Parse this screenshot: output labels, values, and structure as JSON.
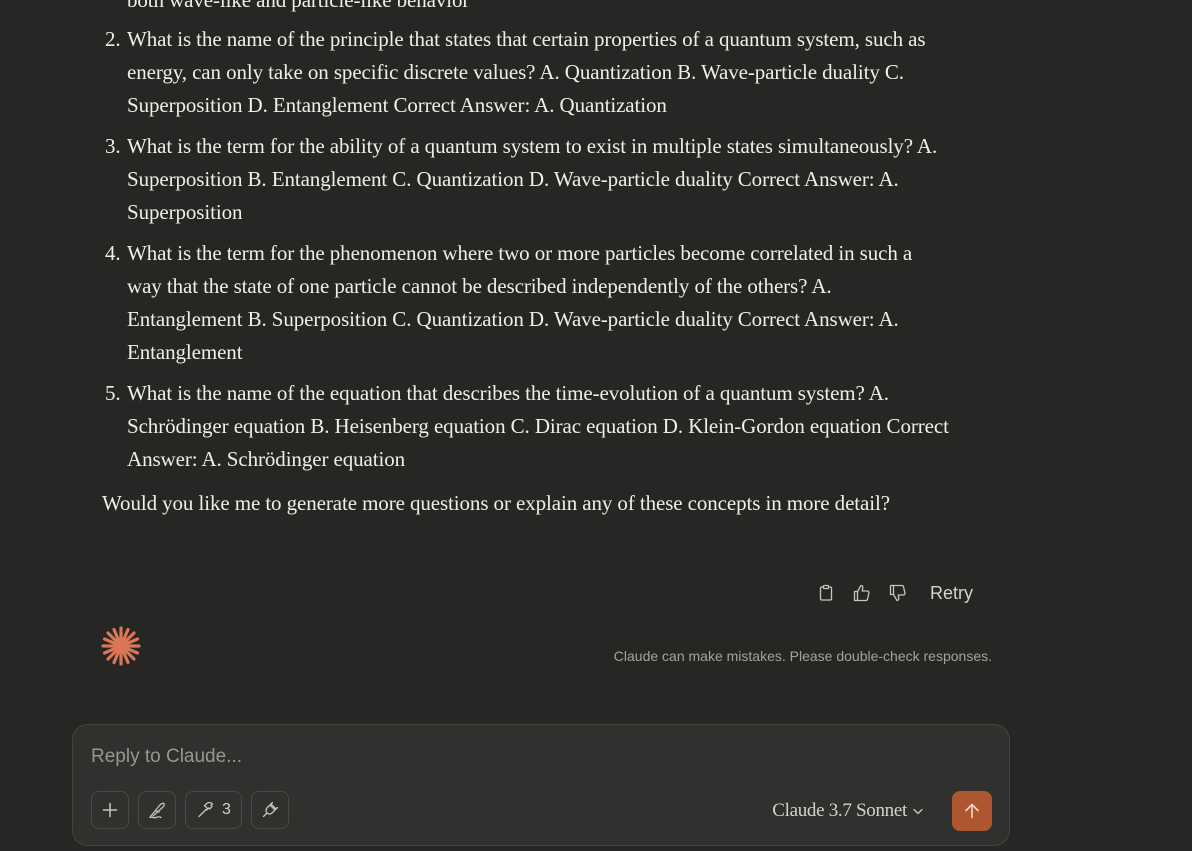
{
  "message": {
    "partial_line": "both wave-like and particle-like behavior",
    "questions": [
      {
        "num": "2.",
        "text": "What is the name of the principle that states that certain properties of a quantum system, such as energy, can only take on specific discrete values? A. Quantization B. Wave-particle duality C. Superposition D. Entanglement Correct Answer: A. Quantization"
      },
      {
        "num": "3.",
        "text": "What is the term for the ability of a quantum system to exist in multiple states simultaneously? A. Superposition B. Entanglement C. Quantization D. Wave-particle duality Correct Answer: A. Superposition"
      },
      {
        "num": "4.",
        "text": "What is the term for the phenomenon where two or more particles become correlated in such a way that the state of one particle cannot be described independently of the others? A. Entanglement B. Superposition C. Quantization D. Wave-particle duality Correct Answer: A. Entanglement"
      },
      {
        "num": "5.",
        "text": "What is the name of the equation that describes the time-evolution of a quantum system? A. Schrödinger equation B. Heisenberg equation C. Dirac equation D. Klein-Gordon equation Correct Answer: A. Schrödinger equation"
      }
    ],
    "followup": "Would you like me to generate more questions or explain any of these concepts in more detail?"
  },
  "actions": {
    "copy_icon": "clipboard-icon",
    "like_icon": "thumbs-up-icon",
    "dislike_icon": "thumbs-down-icon",
    "retry_label": "Retry"
  },
  "disclaimer": "Claude can make mistakes. Please double-check responses.",
  "composer": {
    "placeholder": "Reply to Claude...",
    "tools_count": "3",
    "model_label": "Claude 3.7 Sonnet"
  },
  "colors": {
    "background": "#262624",
    "composer_bg": "#30302e",
    "accent": "#ae5630",
    "logo": "#d97757"
  }
}
